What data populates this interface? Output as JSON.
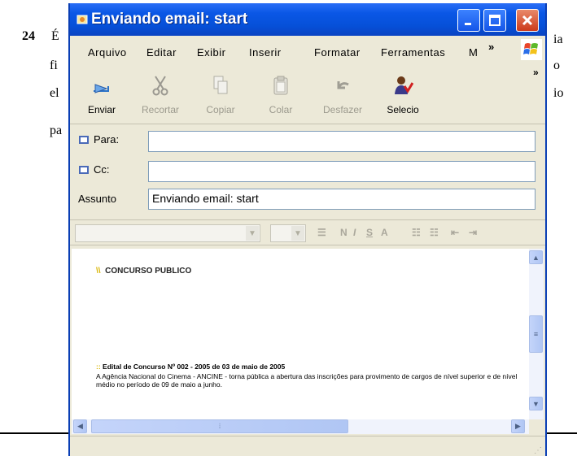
{
  "document": {
    "question_number": "24",
    "line1_start": "É",
    "line1_end": "ia",
    "line2_start": "fi",
    "line2_end": "o",
    "line3_start": "el",
    "line3_end": "io",
    "line4_start": "pa"
  },
  "window": {
    "title": "Enviando email: start"
  },
  "menu": {
    "items": [
      "Arquivo",
      "Editar",
      "Exibir",
      "Inserir",
      "Formatar",
      "Ferramentas",
      "M"
    ],
    "overflow": "»"
  },
  "toolbar": {
    "overflow": "»",
    "buttons": [
      {
        "label": "Enviar",
        "icon": "send-icon",
        "enabled": true
      },
      {
        "label": "Recortar",
        "icon": "scissors-icon",
        "enabled": false
      },
      {
        "label": "Copiar",
        "icon": "copy-icon",
        "enabled": false
      },
      {
        "label": "Colar",
        "icon": "paste-icon",
        "enabled": false
      },
      {
        "label": "Desfazer",
        "icon": "undo-icon",
        "enabled": false
      },
      {
        "label": "Selecio",
        "icon": "check-names-icon",
        "enabled": true
      }
    ]
  },
  "header_fields": {
    "to_label": "Para:",
    "to_value": "",
    "cc_label": "Cc:",
    "cc_value": "",
    "subject_label": "Assunto",
    "subject_value": "Enviando email: start"
  },
  "body": {
    "heading": "CONCURSO PUBLICO",
    "edital_title": "Edital de Concurso Nº 002 - 2005 de 03 de maio de 2005",
    "paragraph": "A Agência Nacional do Cinema - ANCINE - torna pública a abertura das inscrições para provimento de cargos de nível superior e de nível médio no período de 09 de maio a junho."
  },
  "colors": {
    "titlebar": "#0a57e6",
    "chrome": "#ece9d8",
    "close_button": "#d9542f",
    "heading_marker": "#d8b400"
  }
}
